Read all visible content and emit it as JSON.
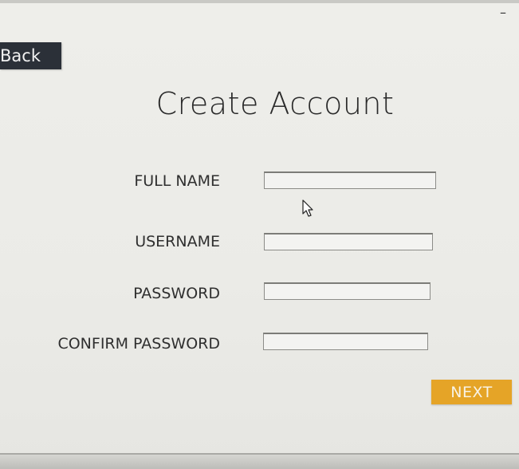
{
  "window": {
    "minimize_glyph": "–"
  },
  "back_button": {
    "label": "Back"
  },
  "page_title": "Create Account",
  "form": {
    "fields": [
      {
        "label": "FULL NAME",
        "value": "",
        "placeholder": ""
      },
      {
        "label": "USERNAME",
        "value": "",
        "placeholder": ""
      },
      {
        "label": "PASSWORD",
        "value": "",
        "placeholder": ""
      },
      {
        "label": "CONFIRM PASSWORD",
        "value": "",
        "placeholder": ""
      }
    ]
  },
  "next_button": {
    "label": "NEXT"
  },
  "colors": {
    "back_bg": "#2b3038",
    "next_bg": "#e5a427",
    "window_bg": "#ecece8"
  },
  "icons": {
    "cursor": "mouse-pointer-icon"
  }
}
